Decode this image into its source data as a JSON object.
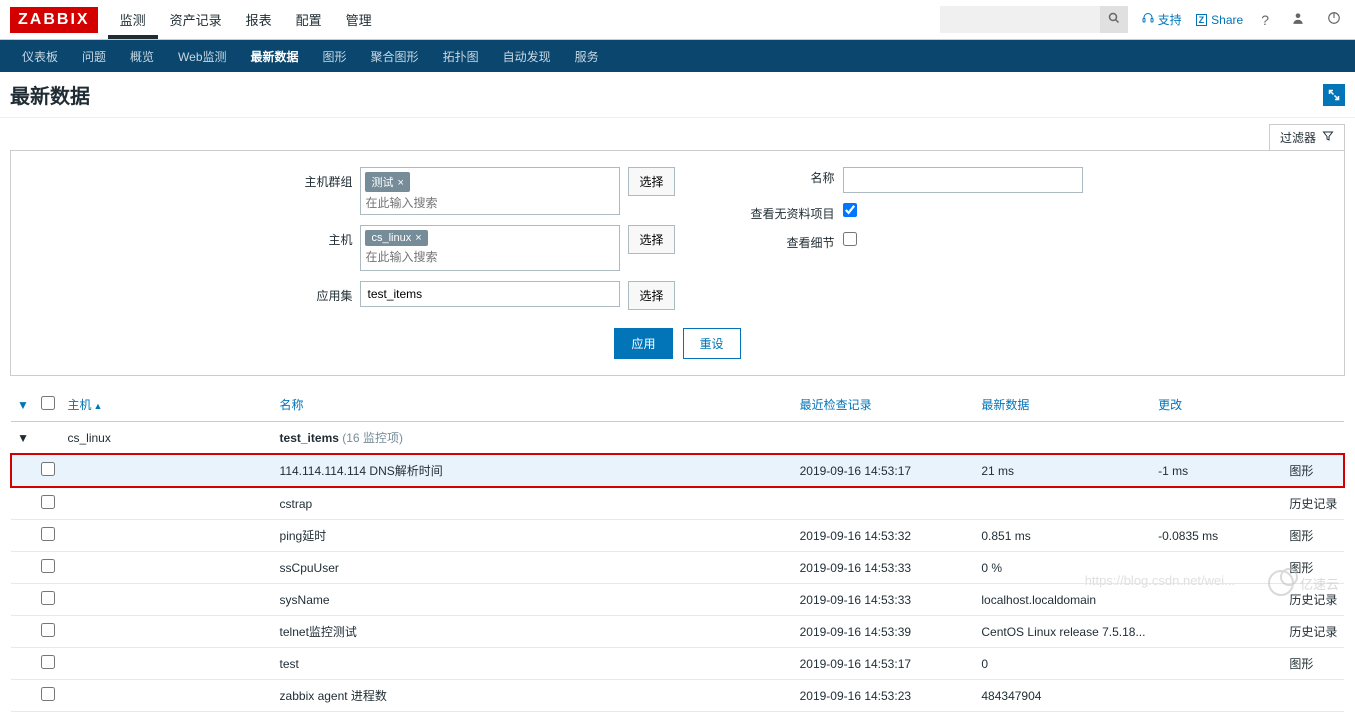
{
  "header": {
    "logo": "ZABBIX",
    "nav": [
      "监测",
      "资产记录",
      "报表",
      "配置",
      "管理"
    ],
    "active_nav_index": 0,
    "search_placeholder": "",
    "support": "支持",
    "share": "Share"
  },
  "subnav": {
    "items": [
      "仪表板",
      "问题",
      "概览",
      "Web监测",
      "最新数据",
      "图形",
      "聚合图形",
      "拓扑图",
      "自动发现",
      "服务"
    ],
    "active_index": 4
  },
  "page": {
    "title": "最新数据",
    "filter_toggle": "过滤器"
  },
  "filter": {
    "labels": {
      "host_group": "主机群组",
      "host": "主机",
      "application": "应用集",
      "name": "名称",
      "show_no_data": "查看无资料项目",
      "show_details": "查看细节"
    },
    "host_group_tag": "测试",
    "host_tag": "cs_linux",
    "placeholder": "在此输入搜索",
    "application_value": "test_items",
    "select_btn": "选择",
    "apply": "应用",
    "reset": "重设",
    "show_no_data_checked": true,
    "show_details_checked": false
  },
  "table": {
    "headers": {
      "host": "主机",
      "name": "名称",
      "last_check": "最近检查记录",
      "latest_data": "最新数据",
      "change": "更改"
    },
    "group": {
      "host": "cs_linux",
      "app": "test_items",
      "count_label": "(16 监控项)"
    },
    "rows": [
      {
        "highlighted": true,
        "name": "114.114.114.114 DNS解析时间",
        "last_check": "2019-09-16 14:53:17",
        "latest": "21 ms",
        "change": "-1 ms",
        "action": "图形"
      },
      {
        "highlighted": false,
        "name": "cstrap",
        "last_check": "",
        "latest": "",
        "change": "",
        "action": "历史记录"
      },
      {
        "highlighted": false,
        "name": "ping延时",
        "last_check": "2019-09-16 14:53:32",
        "latest": "0.851 ms",
        "change": "-0.0835 ms",
        "action": "图形"
      },
      {
        "highlighted": false,
        "name": "ssCpuUser",
        "last_check": "2019-09-16 14:53:33",
        "latest": "0 %",
        "change": "",
        "action": "图形"
      },
      {
        "highlighted": false,
        "name": "sysName",
        "last_check": "2019-09-16 14:53:33",
        "latest": "localhost.localdomain",
        "change": "",
        "action": "历史记录"
      },
      {
        "highlighted": false,
        "name": "telnet监控测试",
        "last_check": "2019-09-16 14:53:39",
        "latest": "CentOS Linux release 7.5.18...",
        "change": "",
        "action": "历史记录"
      },
      {
        "highlighted": false,
        "name": "test",
        "last_check": "2019-09-16 14:53:17",
        "latest": "0",
        "change": "",
        "action": "图形"
      },
      {
        "highlighted": false,
        "name": "zabbix agent 进程数",
        "last_check": "2019-09-16 14:53:23",
        "latest": "484347904",
        "change": "",
        "action": ""
      }
    ]
  },
  "watermark": {
    "url": "https://blog.csdn.net/wei...",
    "brand": "亿速云"
  }
}
